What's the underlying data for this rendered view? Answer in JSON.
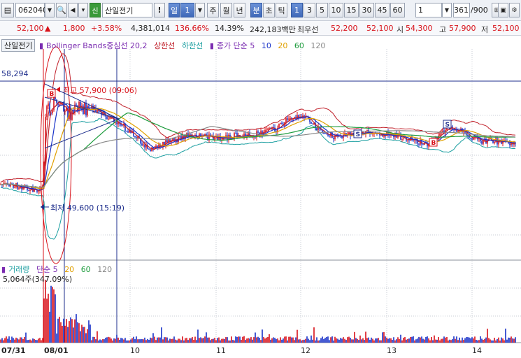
{
  "toolbar": {
    "code": "062040",
    "stock_name": "산일전기",
    "badge": "신",
    "period_day": "일",
    "period_num": "1",
    "periods": [
      "주",
      "월",
      "년",
      "분",
      "초",
      "틱"
    ],
    "intervals": [
      "1",
      "3",
      "5",
      "10",
      "15",
      "30",
      "45",
      "60"
    ],
    "selected_interval": "1",
    "count_select": "1",
    "count_value": "361",
    "count_total": "/900",
    "exclaim": "!"
  },
  "quote": {
    "price": "52,100",
    "change": "1,800",
    "change_pct": "+3.58%",
    "volume": "4,381,014",
    "volume_ratio": "136.66%",
    "turnover_pct": "14.39%",
    "amount": "242,183백만",
    "best_label": "최우선",
    "best_ask": "52,200",
    "best_bid": "52,100",
    "open_label": "시",
    "open": "54,300",
    "high_label": "고",
    "high": "57,900",
    "low_label": "저",
    "low": "52,100"
  },
  "main_panel": {
    "title": "산일전기",
    "legend": {
      "bb_label": "Bollinger Bands중심선 20,2",
      "upper": "상한선",
      "lower": "하한선",
      "ma_label": "종가 단순 5",
      "ma10": "10",
      "ma20": "20",
      "ma60": "60",
      "ma120": "120"
    },
    "price_marker": "58,294",
    "high_annotation": "최고 57,900 (09:06)",
    "low_annotation": "최저 49,600 (15:19)"
  },
  "volume_panel": {
    "legend": {
      "vol_label": "거래량",
      "ma_label": "단순 5",
      "ma20": "20",
      "ma60": "60",
      "ma120": "120"
    },
    "value_text": "5,064주(347.09%)"
  },
  "x_axis": {
    "labels": [
      "07/31",
      "08/01",
      "10",
      "11",
      "12",
      "13",
      "14"
    ]
  },
  "colors": {
    "up": "#d8121a",
    "down": "#1832c8",
    "bb_band": "#c0202a",
    "bb_lower": "#1a9ea0",
    "ma5": "#c0202a",
    "ma10": "#1832c8",
    "ma20": "#e0a000",
    "ma60": "#1a9a3a",
    "ma120": "#888888"
  },
  "icons": [
    "clipboard-icon",
    "search-icon",
    "speaker-icon",
    "exclamation-icon",
    "grid-icon",
    "save-icon",
    "settings-icon"
  ]
}
